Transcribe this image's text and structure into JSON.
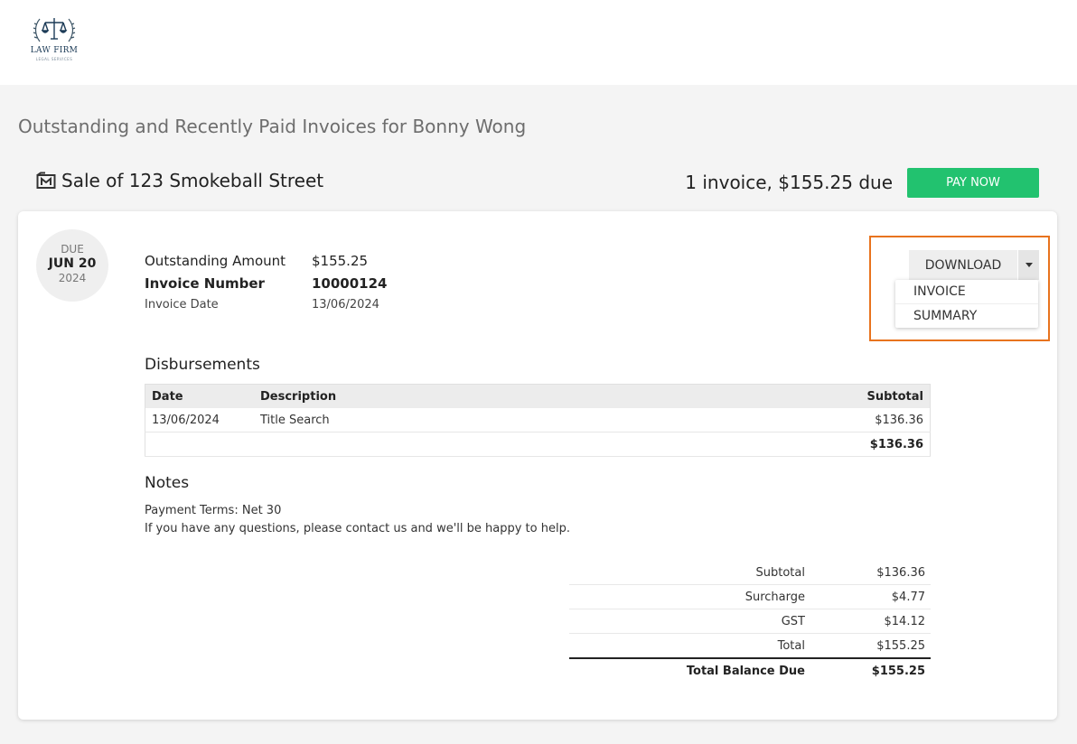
{
  "brand": {
    "logo_text": "LAW FIRM",
    "logo_subtext": "LEGAL SERVICES"
  },
  "page": {
    "title": "Outstanding and Recently Paid Invoices for Bonny Wong"
  },
  "matter": {
    "title": "Sale of 123 Smokeball Street",
    "summary": "1 invoice, $155.25 due",
    "pay_now_label": "PAY NOW"
  },
  "invoice": {
    "due": {
      "label": "DUE",
      "date": "JUN 20",
      "year": "2024"
    },
    "outstanding_label": "Outstanding Amount",
    "outstanding_value": "$155.25",
    "number_label": "Invoice Number",
    "number_value": "10000124",
    "date_label": "Invoice Date",
    "date_value": "13/06/2024",
    "download": {
      "label": "DOWNLOAD",
      "menu": [
        "INVOICE",
        "SUMMARY"
      ]
    },
    "disbursements": {
      "heading": "Disbursements",
      "columns": {
        "date": "Date",
        "description": "Description",
        "subtotal": "Subtotal"
      },
      "rows": [
        {
          "date": "13/06/2024",
          "description": "Title Search",
          "subtotal": "$136.36"
        }
      ],
      "total": "$136.36"
    },
    "notes": {
      "heading": "Notes",
      "line1": "Payment Terms: Net 30",
      "line2": "If you have any questions, please contact us and we'll be happy to help."
    },
    "totals": {
      "subtotal_label": "Subtotal",
      "subtotal_value": "$136.36",
      "surcharge_label": "Surcharge",
      "surcharge_value": "$4.77",
      "gst_label": "GST",
      "gst_value": "$14.12",
      "total_label": "Total",
      "total_value": "$155.25",
      "balance_label": "Total Balance Due",
      "balance_value": "$155.25"
    }
  },
  "colors": {
    "accent_green": "#22c26f",
    "highlight_orange": "#e8731e"
  }
}
